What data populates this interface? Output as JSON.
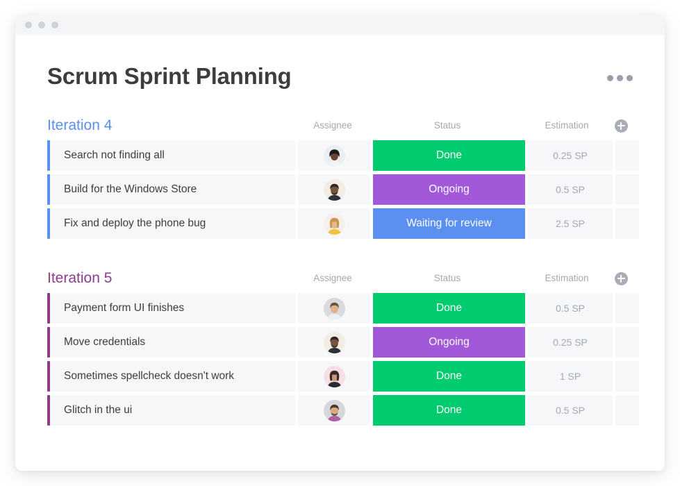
{
  "window": {
    "dots": [
      "dot-1",
      "dot-2",
      "dot-3"
    ]
  },
  "header": {
    "title": "Scrum Sprint Planning",
    "menu_icon": "kebab-menu-icon"
  },
  "columns": {
    "assignee": "Assignee",
    "status": "Status",
    "estimation": "Estimation",
    "add": "+"
  },
  "colors": {
    "iteration4_accent": "#5b8ff0",
    "iteration5_accent": "#8d3b8e",
    "status_done": "#00cb6e",
    "status_ongoing": "#a martin",
    "status_ongoing_hex": "#a martin",
    "done": "#00cb6e",
    "ongoing": "#a259d9",
    "waiting": "#5b8ff0",
    "row_bg": "#f6f7f9",
    "title_text": "#3d3d3d",
    "muted_text": "#a4a8b2"
  },
  "groups": [
    {
      "name": "Iteration 4",
      "accent": "blue",
      "rows": [
        {
          "title": "Search not finding all",
          "assignee": "avatar-woman-dark-hair",
          "status": "Done",
          "status_color": "#00cb6e",
          "estimation": "0.25 SP"
        },
        {
          "title": "Build for the Windows Store",
          "assignee": "avatar-man-beard",
          "status": "Ongoing",
          "status_color": "#a259d9",
          "estimation": "0.5 SP"
        },
        {
          "title": "Fix and deploy the phone bug",
          "assignee": "avatar-woman-blonde",
          "status": "Waiting for review",
          "status_color": "#5b8ff0",
          "estimation": "2.5 SP"
        }
      ]
    },
    {
      "name": "Iteration 5",
      "accent": "purple",
      "rows": [
        {
          "title": "Payment form UI finishes",
          "assignee": "avatar-man-short-hair",
          "status": "Done",
          "status_color": "#00cb6e",
          "estimation": "0.5 SP"
        },
        {
          "title": "Move credentials",
          "assignee": "avatar-man-beard",
          "status": "Ongoing",
          "status_color": "#a259d9",
          "estimation": "0.25 SP"
        },
        {
          "title": "Sometimes spellcheck doesn't work",
          "assignee": "avatar-woman-pink-bg",
          "status": "Done",
          "status_color": "#00cb6e",
          "estimation": "1 SP"
        },
        {
          "title": "Glitch in the ui",
          "assignee": "avatar-man-bearded-grey",
          "status": "Done",
          "status_color": "#00cb6e",
          "estimation": "0.5 SP"
        }
      ]
    }
  ]
}
